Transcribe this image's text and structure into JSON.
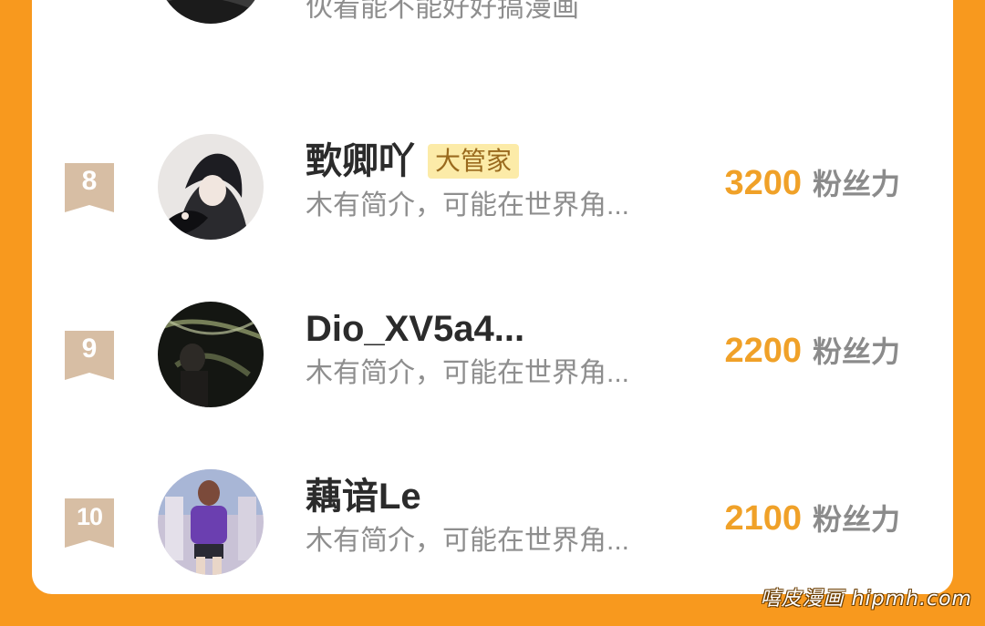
{
  "partial_row": {
    "bio": "伙看能不能好好搞漫画"
  },
  "rows": [
    {
      "rank": "8",
      "name": "歅卿吖",
      "tag": "大管家",
      "bio": "木有简介，可能在世界角...",
      "fans": "3200",
      "fans_label": "粉丝力"
    },
    {
      "rank": "9",
      "name": "Dio_XV5a4...",
      "tag": "",
      "bio": "木有简介，可能在世界角...",
      "fans": "2200",
      "fans_label": "粉丝力"
    },
    {
      "rank": "10",
      "name": "藕谙Le",
      "tag": "",
      "bio": "木有简介，可能在世界角...",
      "fans": "2100",
      "fans_label": "粉丝力"
    }
  ],
  "colors": {
    "page_bg": "#F8991E",
    "card_bg": "#FFFFFF",
    "fans_count": "#F0A128",
    "rank_badge": "#D7BEA4",
    "tag_bg": "#FCEBA8"
  },
  "watermark": "嘻皮漫画 hipmh.com"
}
